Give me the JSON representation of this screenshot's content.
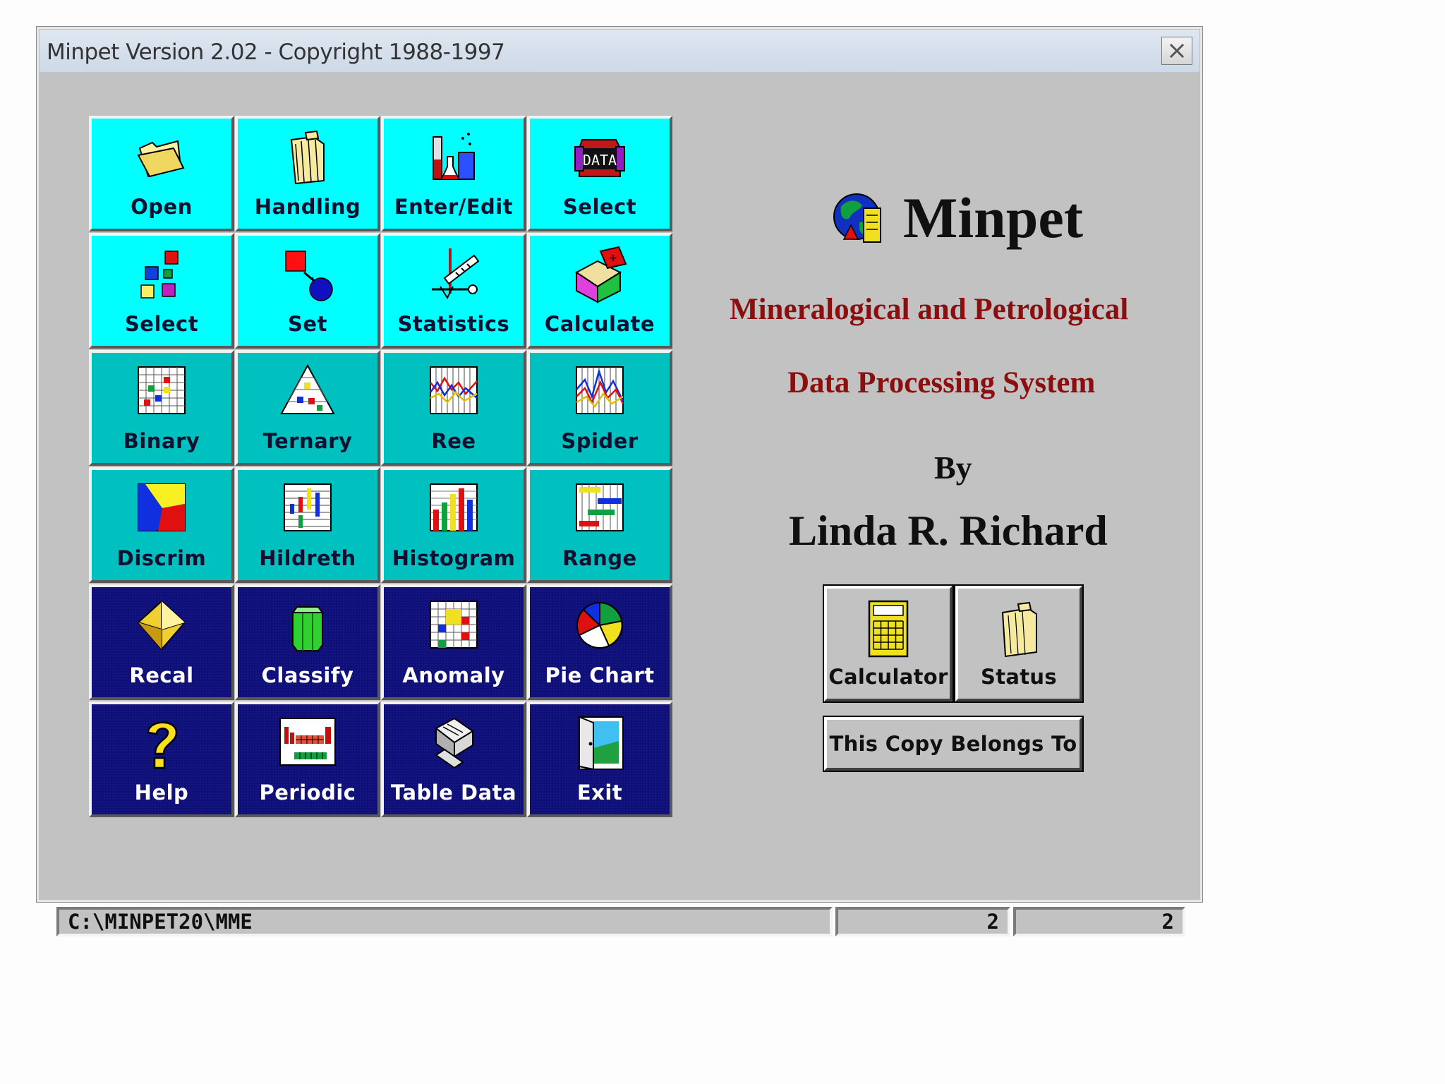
{
  "window": {
    "title": "Minpet Version 2.02 - Copyright 1988-1997"
  },
  "tiles": [
    {
      "label": "Open",
      "icon": "folder-open-icon",
      "style": "cyan"
    },
    {
      "label": "Handling",
      "icon": "file-folder-icon",
      "style": "cyan"
    },
    {
      "label": "Enter/Edit",
      "icon": "lab-flask-icon",
      "style": "cyan"
    },
    {
      "label": "Select",
      "icon": "data-icon",
      "style": "cyan"
    },
    {
      "label": "Select",
      "icon": "colored-squares-icon",
      "style": "cyan"
    },
    {
      "label": "Set",
      "icon": "set-shapes-icon",
      "style": "cyan"
    },
    {
      "label": "Statistics",
      "icon": "statistics-tools-icon",
      "style": "cyan"
    },
    {
      "label": "Calculate",
      "icon": "calculate-cube-icon",
      "style": "cyan"
    },
    {
      "label": "Binary",
      "icon": "binary-plot-icon",
      "style": "teal"
    },
    {
      "label": "Ternary",
      "icon": "ternary-plot-icon",
      "style": "teal"
    },
    {
      "label": "Ree",
      "icon": "ree-plot-icon",
      "style": "teal"
    },
    {
      "label": "Spider",
      "icon": "spider-plot-icon",
      "style": "teal"
    },
    {
      "label": "Discrim",
      "icon": "discrim-plot-icon",
      "style": "teal"
    },
    {
      "label": "Hildreth",
      "icon": "hildreth-plot-icon",
      "style": "teal"
    },
    {
      "label": "Histogram",
      "icon": "histogram-icon",
      "style": "teal"
    },
    {
      "label": "Range",
      "icon": "range-plot-icon",
      "style": "teal"
    },
    {
      "label": "Recal",
      "icon": "crystal-icon",
      "style": "navy"
    },
    {
      "label": "Classify",
      "icon": "prism-icon",
      "style": "navy"
    },
    {
      "label": "Anomaly",
      "icon": "anomaly-grid-icon",
      "style": "navy"
    },
    {
      "label": "Pie Chart",
      "icon": "pie-chart-icon",
      "style": "navy"
    },
    {
      "label": "Help",
      "icon": "question-mark-icon",
      "style": "navy"
    },
    {
      "label": "Periodic",
      "icon": "periodic-table-icon",
      "style": "navy"
    },
    {
      "label": "Table Data",
      "icon": "table-data-icon",
      "style": "navy"
    },
    {
      "label": "Exit",
      "icon": "exit-door-icon",
      "style": "navy"
    }
  ],
  "brand": {
    "name": "Minpet",
    "icon": "globe-icon"
  },
  "subtitle": {
    "line1": "Mineralogical and Petrological",
    "line2": "Data Processing System"
  },
  "credit": {
    "by": "By",
    "author": "Linda R. Richard"
  },
  "buttons": {
    "calculator": "Calculator",
    "status": "Status",
    "copy": "This Copy Belongs To"
  },
  "statusbar": {
    "path": "C:\\MINPET20\\MME",
    "count_a": "2",
    "count_b": "2"
  },
  "colors": {
    "cyan": "#00ffff",
    "teal": "#00c0c0",
    "navy": "#0f0f78",
    "subtitle": "#8b0f0f",
    "window_bg": "#c2c2c2"
  }
}
